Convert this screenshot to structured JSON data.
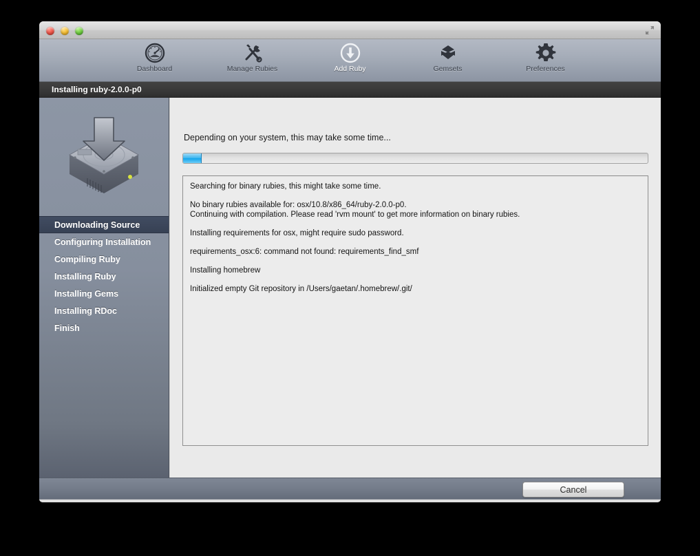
{
  "window": {
    "traffic_lights": [
      "close",
      "minimize",
      "zoom"
    ],
    "fullscreen_icon": "fullscreen-arrows-icon"
  },
  "toolbar": {
    "items": [
      {
        "label": "Dashboard",
        "icon": "gauge-icon",
        "selected": false
      },
      {
        "label": "Manage Rubies",
        "icon": "tools-icon",
        "selected": false
      },
      {
        "label": "Add Ruby",
        "icon": "download-circle-icon",
        "selected": true
      },
      {
        "label": "Gemsets",
        "icon": "gembox-icon",
        "selected": false
      },
      {
        "label": "Preferences",
        "icon": "gear-icon",
        "selected": false
      }
    ]
  },
  "section": {
    "title": "Installing ruby-2.0.0-p0"
  },
  "sidebar": {
    "icon": "hard-drive-download-icon",
    "steps": [
      {
        "label": "Downloading Source",
        "active": true
      },
      {
        "label": "Configuring Installation",
        "active": false
      },
      {
        "label": "Compiling Ruby",
        "active": false
      },
      {
        "label": "Installing Ruby",
        "active": false
      },
      {
        "label": "Installing Gems",
        "active": false
      },
      {
        "label": "Installing RDoc",
        "active": false
      },
      {
        "label": "Finish",
        "active": false
      }
    ]
  },
  "content": {
    "status_text": "Depending on your system, this may take some time...",
    "progress": {
      "percent": 4,
      "label": ""
    },
    "log_lines": [
      "Searching for binary rubies, this might take some time.",
      "",
      "No binary rubies available for: osx/10.8/x86_64/ruby-2.0.0-p0.",
      "Continuing with compilation. Please read 'rvm mount' to get more information on binary rubies.",
      "",
      "Installing requirements for osx, might require sudo password.",
      "",
      "requirements_osx:6: command not found: requirements_find_smf",
      "",
      "Installing homebrew",
      "",
      "Initialized empty Git repository in /Users/gaetan/.homebrew/.git/"
    ]
  },
  "footer": {
    "cancel_label": "Cancel"
  },
  "colors": {
    "accent_progress": "#12a5ec",
    "sidebar_active": "#3b4659",
    "header_dark": "#3a3a3a",
    "toolbar": "#a6adb9"
  }
}
